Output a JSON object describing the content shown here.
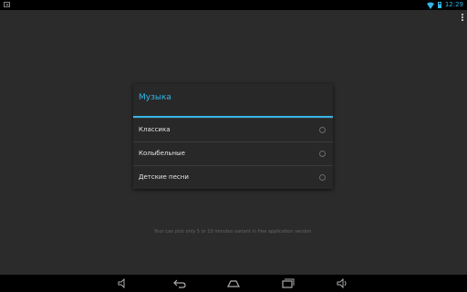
{
  "status_bar": {
    "time": "12:29",
    "colors": {
      "accent": "#33b5e5"
    }
  },
  "dialog": {
    "title": "Музыка",
    "options": [
      {
        "label": "Классика",
        "selected": false
      },
      {
        "label": "Колыбельные",
        "selected": false
      },
      {
        "label": "Детские песни",
        "selected": false
      }
    ]
  },
  "footer_note": "Your can pick only 5 or 10 minutes variant in free application version.",
  "nav_bar": {
    "icons": [
      "volume-down-icon",
      "back-icon",
      "home-icon",
      "recent-apps-icon",
      "volume-up-icon"
    ]
  }
}
